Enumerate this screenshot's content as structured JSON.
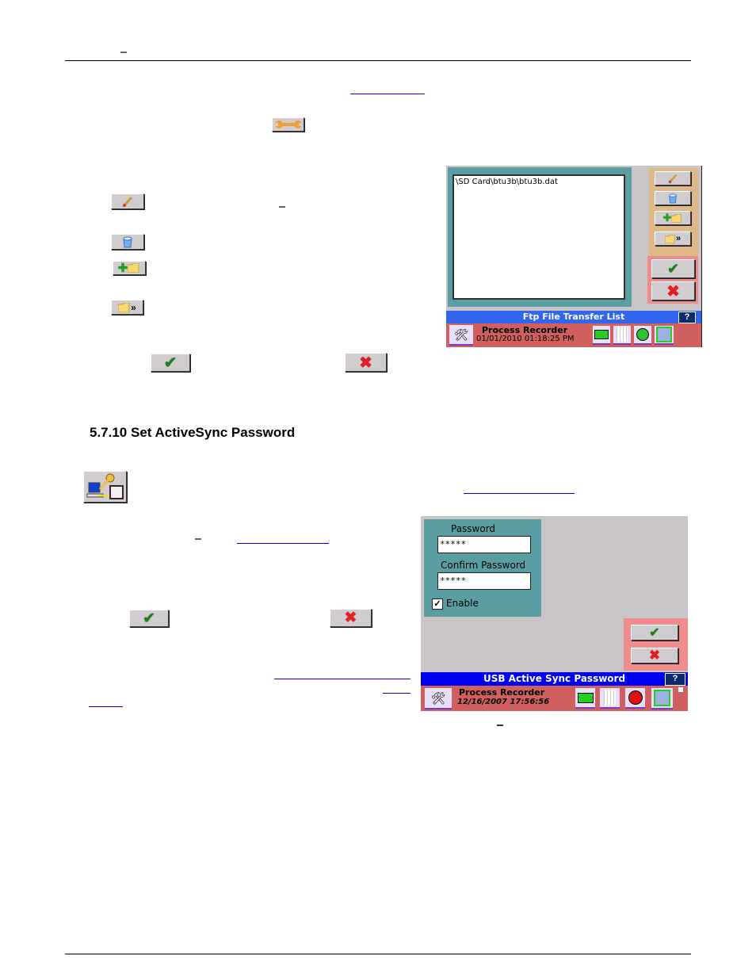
{
  "page": {
    "header_dash": "–",
    "section_heading": "5.7.10  Set ActiveSync Password"
  },
  "ftp_screenshot": {
    "file_list": [
      "\\SD Card\\btu3b\\btu3b.dat"
    ],
    "side_buttons": [
      "edit-icon",
      "delete-bucket-icon",
      "add-folder-icon",
      "folder-next-icon"
    ],
    "ok_icon": "checkmark-icon",
    "cancel_icon": "x-icon",
    "title": "Ftp File Transfer List",
    "help_label": "?",
    "status": {
      "app_name": "Process Recorder",
      "datetime": "01/01/2010 01:18:25 PM"
    }
  },
  "password_screenshot": {
    "password_label": "Password",
    "password_value": "*****",
    "confirm_label": "Confirm Password",
    "confirm_value": "*****",
    "enable_label": "Enable",
    "enable_checked": "✓",
    "title": "USB Active Sync Password",
    "help_label": "?",
    "status": {
      "app_name": "Process Recorder",
      "datetime": "12/16/2007 17:56:56"
    }
  },
  "colors": {
    "panel_teal": "#5a9ea3",
    "button_panel_tan": "#deb887",
    "ok_panel_pink": "#f08c8c",
    "status_bar_red": "#d06060",
    "title_blue_ftp": "#3366ee",
    "title_blue_usb": "#0000f0",
    "link_blue": "#0000e0"
  }
}
